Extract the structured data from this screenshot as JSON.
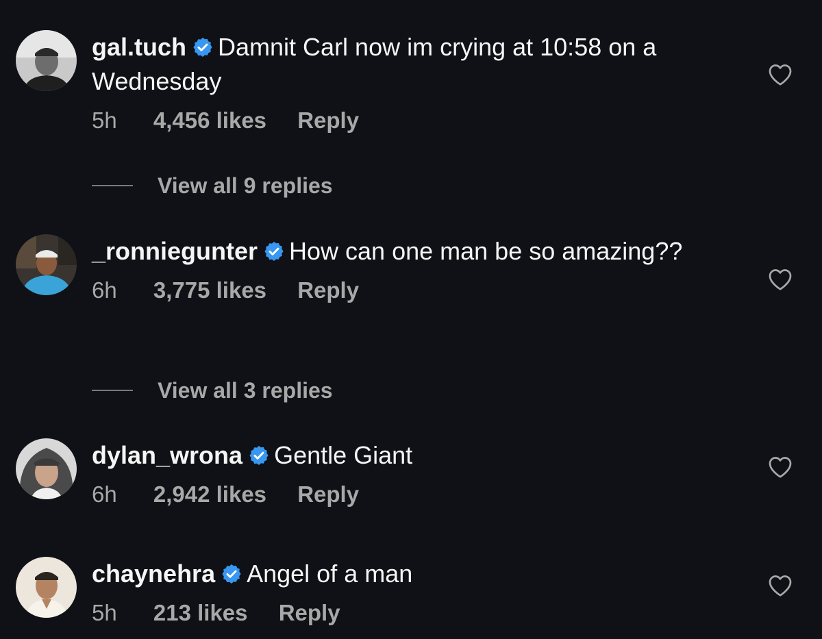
{
  "comments": [
    {
      "username": "gal.tuch",
      "text": "Damnit Carl now im crying at 10:58 on a Wednesday",
      "time": "5h",
      "likes": "4,456 likes",
      "reply_label": "Reply",
      "view_replies": "View all 9 replies"
    },
    {
      "username": "_ronniegunter",
      "text": "How can one man be so amazing??",
      "time": "6h",
      "likes": "3,775 likes",
      "reply_label": "Reply",
      "view_replies": "View all 3 replies"
    },
    {
      "username": "dylan_wrona",
      "text": "Gentle Giant",
      "time": "6h",
      "likes": "2,942 likes",
      "reply_label": "Reply"
    },
    {
      "username": "chaynehra",
      "text": "Angel of a man",
      "time": "5h",
      "likes": "213 likes",
      "reply_label": "Reply"
    }
  ],
  "icons": {
    "verified": "verified-badge-icon",
    "like": "heart-outline-icon"
  },
  "colors": {
    "background": "#0f1116",
    "text": "#f5f5f5",
    "muted": "#a8a8a8",
    "verified": "#3897f0"
  }
}
